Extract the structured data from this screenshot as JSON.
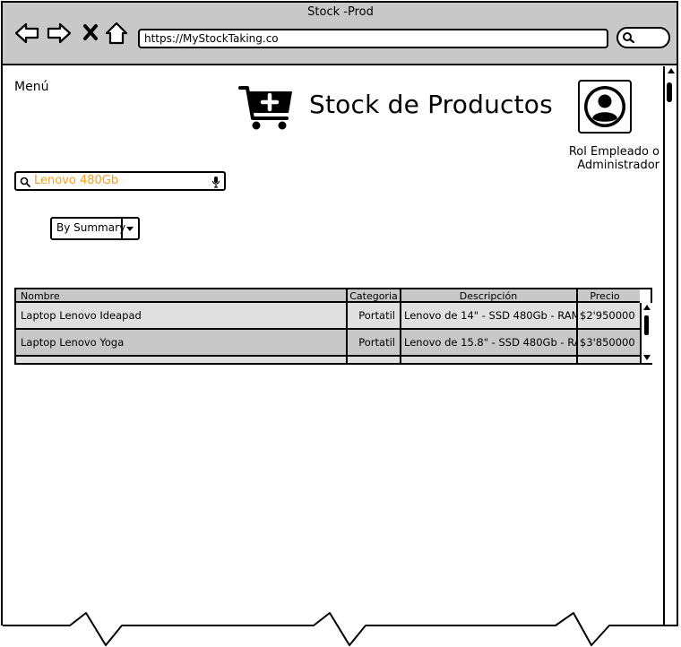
{
  "window": {
    "title": "Stock -Prod"
  },
  "browser": {
    "url": "https://MyStockTaking.co"
  },
  "sidebar": {
    "menu_label": "Menú"
  },
  "header": {
    "title": "Stock de Productos",
    "role": "Rol Empleado o Administrador"
  },
  "search": {
    "value": "Lenovo 480Gb",
    "value_color": "#f0a020"
  },
  "view_select": {
    "selected": "By Summary"
  },
  "table": {
    "columns": [
      "Nombre",
      "Categoria",
      "Descripción",
      "Precio"
    ],
    "rows": [
      {
        "nombre": "Laptop Lenovo Ideapad",
        "categoria": "Portatil",
        "descripcion": "Lenovo de 14\" - SSD 480Gb - RAM",
        "precio": "$2'950000"
      },
      {
        "nombre": "Laptop Lenovo Yoga",
        "categoria": "Portatil",
        "descripcion": "Lenovo de 15.8\" - SSD 480Gb - RA",
        "precio": "$3'850000"
      }
    ]
  },
  "icons": [
    "back-arrow-icon",
    "forward-arrow-icon",
    "close-icon",
    "home-icon",
    "search-icon",
    "mic-icon",
    "add-to-cart-icon",
    "user-avatar-icon",
    "chevron-down-icon"
  ]
}
